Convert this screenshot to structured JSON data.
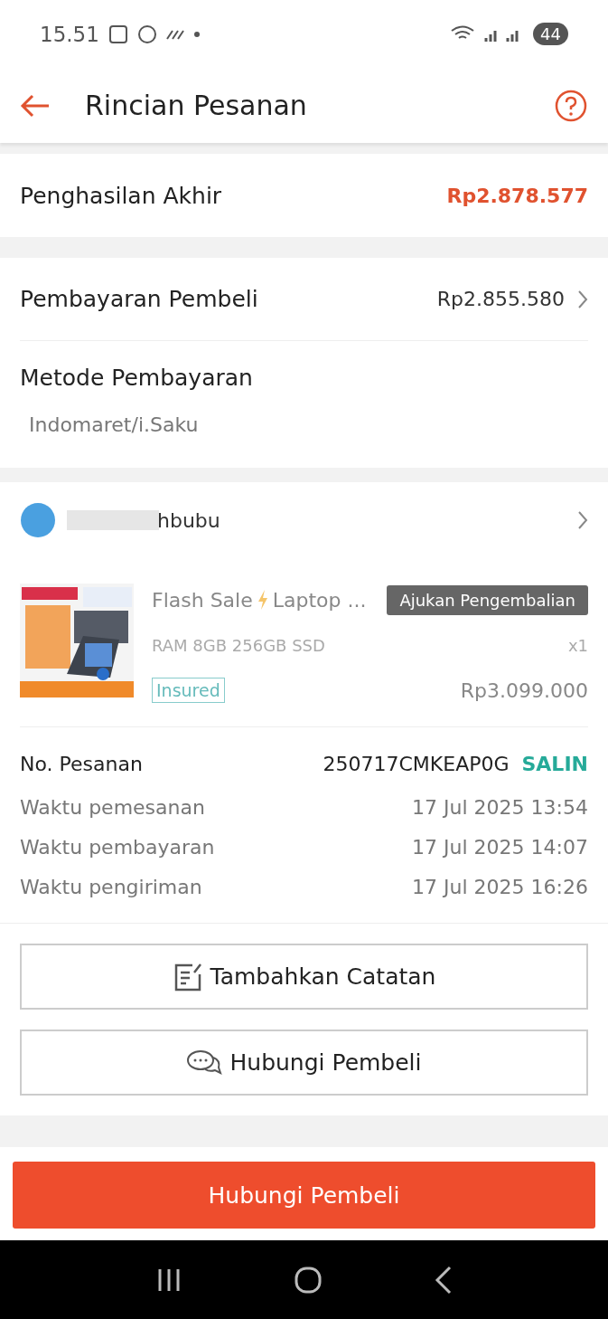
{
  "status_bar": {
    "time": "15.51",
    "battery": "44"
  },
  "header": {
    "title": "Rincian Pesanan"
  },
  "earnings": {
    "label": "Penghasilan Akhir",
    "amount": "Rp2.878.577"
  },
  "payment": {
    "label": "Pembayaran Pembeli",
    "amount": "Rp2.855.580",
    "method_label": "Metode Pembayaran",
    "method": "Indomaret/i.Saku"
  },
  "buyer": {
    "name": "hbubu"
  },
  "product": {
    "title": "Flash Sale",
    "title_rest": "Laptop ...",
    "return_button": "Ajukan Pengembalian",
    "variant": "RAM 8GB 256GB SSD",
    "quantity": "x1",
    "tag": "Insured",
    "price": "Rp3.099.000"
  },
  "order_info": {
    "number_label": "No. Pesanan",
    "number": "250717CMKEAP0G",
    "copy": "SALIN",
    "rows": [
      {
        "label": "Waktu pemesanan",
        "value": "17 Jul 2025 13:54"
      },
      {
        "label": "Waktu pembayaran",
        "value": "17 Jul 2025 14:07"
      },
      {
        "label": "Waktu pengiriman",
        "value": "17 Jul 2025 16:26"
      }
    ]
  },
  "actions": [
    {
      "kind": "note",
      "label": "Tambahkan Catatan"
    },
    {
      "kind": "chat",
      "label": "Hubungi Pembeli"
    }
  ],
  "primary_button": "Hubungi Pembeli"
}
